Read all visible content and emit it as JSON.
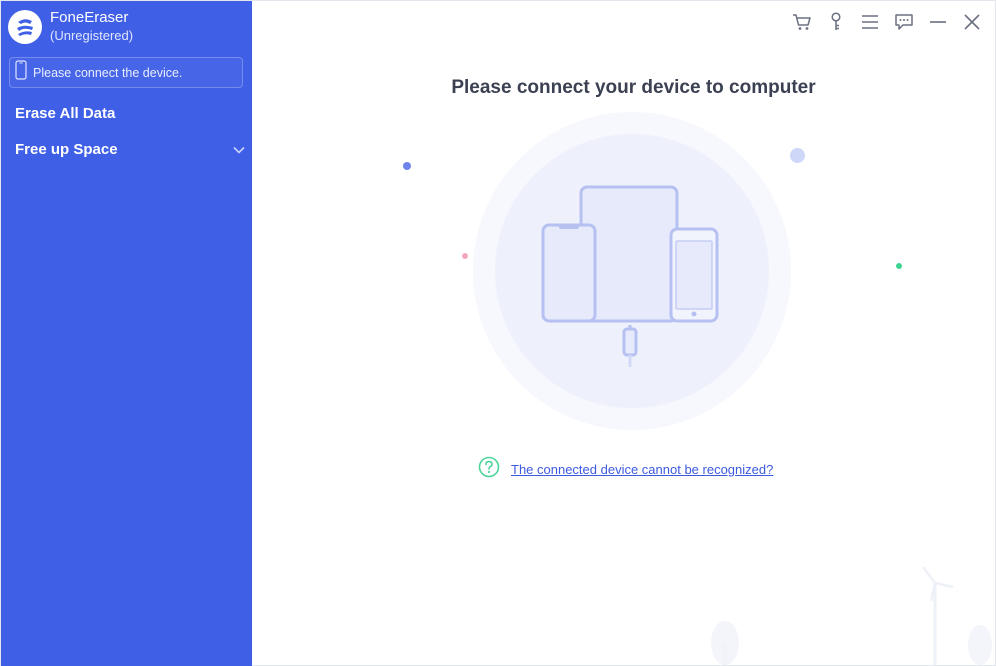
{
  "app": {
    "name": "FoneEraser",
    "status": "(Unregistered)",
    "logo_icon": "foneeraser-logo-icon"
  },
  "sidebar": {
    "device_status": "Please connect the device.",
    "device_icon": "phone-icon",
    "items": [
      {
        "label": "Erase All Data"
      },
      {
        "label": "Free up Space",
        "icon": "chevron-down-icon"
      }
    ]
  },
  "window_controls": {
    "icons": [
      "cart-icon",
      "key-icon",
      "menu-icon",
      "feedback-icon",
      "minimize-icon",
      "close-icon"
    ]
  },
  "main": {
    "title": "Please connect your device to computer",
    "help_link": "The connected device cannot be recognized?",
    "help_icon": "question-circle-icon",
    "illustration_icon": "devices-illustration-icon"
  },
  "colors": {
    "sidebar_bg": "#3f5fe6",
    "accent": "#3c5ae0",
    "help_icon": "#4cd49a",
    "title": "#3b4152"
  }
}
